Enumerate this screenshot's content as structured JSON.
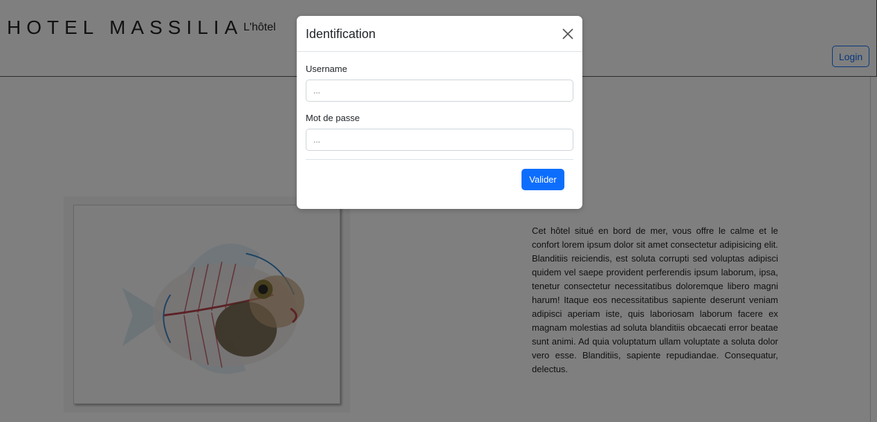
{
  "navbar": {
    "brand": "HOTEL MASSILIA",
    "link_hotel": "L'hôtel",
    "login_label": "Login"
  },
  "main": {
    "description": "Cet hôtel situé en bord de mer, vous offre le calme et le confort lorem ipsum dolor sit amet consectetur adipisicing elit. Blanditiis reiciendis, est soluta corrupti sed voluptas adipisci quidem vel saepe provident perferendis ipsum laborum, ipsa, tenetur consectetur necessitatibus doloremque libero magni harum! Itaque eos necessitatibus sapiente deserunt veniam adipisci aperiam iste, quis laboriosam laborum facere ex magnam molestias ad soluta blanditiis obcaecati error beatae sunt animi. Ad quia voluptatum ullam voluptate a soluta dolor vero esse. Blanditiis, sapiente repudiandae. Consequatur, delectus."
  },
  "modal": {
    "title": "Identification",
    "username_label": "Username",
    "username_placeholder": "...",
    "password_label": "Mot de passe",
    "password_placeholder": "...",
    "submit_label": "Valider"
  },
  "colors": {
    "primary": "#0d6efd",
    "backdrop": "rgba(0,0,0,0.5)"
  },
  "icons": {
    "close": "close-icon"
  }
}
